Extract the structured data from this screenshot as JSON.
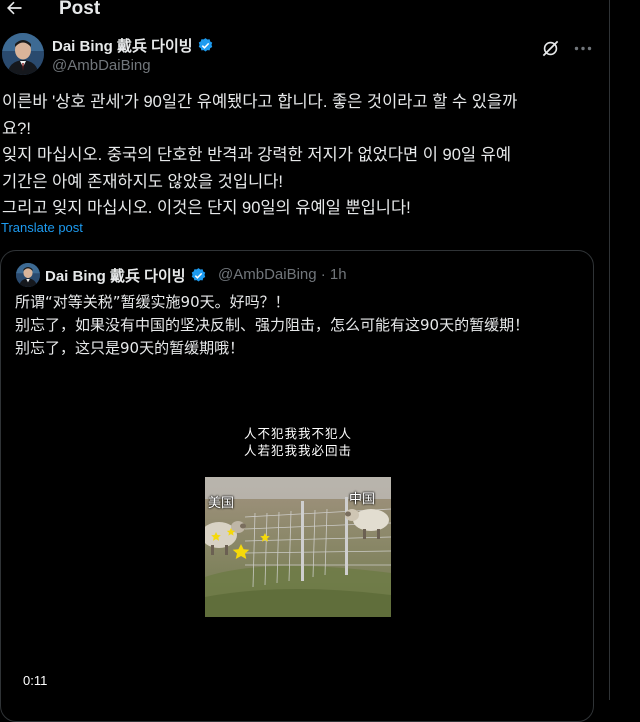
{
  "header": {
    "title": "Post"
  },
  "author": {
    "name": "Dai Bing 戴兵 다이빙",
    "handle": "@AmbDaiBing"
  },
  "post": {
    "lines": [
      "이른바 '상호 관세'가 90일간 유예됐다고 합니다. 좋은 것이라고 할 수 있을까",
      "요?!",
      "잊지 마십시오. 중국의 단호한 반격과 강력한 저지가 없었다면 이 90일 유예",
      "기간은 아예 존재하지도 않았을 것입니다!",
      "그리고 잊지 마십시오. 이것은 단지 90일의 유예일 뿐입니다!"
    ],
    "translate_label": "Translate post"
  },
  "quote": {
    "name": "Dai Bing 戴兵 다이빙",
    "meta": "@AmbDaiBing · 1h",
    "lines": [
      "所谓“对等关税”暂缓实施90天。好吗？！",
      "别忘了，如果没有中国的坚决反制、强力阻击，怎么可能有这90天的暂缓期！",
      "别忘了，这只是90天的暂缓期哦！"
    ],
    "video": {
      "caption_line1": "人不犯我我不犯人",
      "caption_line2": "人若犯我我必回击",
      "label_left": "美国",
      "label_right": "中国",
      "timestamp": "0:11"
    }
  },
  "icons": {
    "back": "arrow-left-icon",
    "verified": "verified-badge-icon",
    "grok": "grok-icon",
    "more": "more-dots-icon"
  },
  "colors": {
    "background": "#000000",
    "text": "#e7e9ea",
    "secondary": "#71767b",
    "accent": "#1d9bf0",
    "border": "#2f3336"
  }
}
